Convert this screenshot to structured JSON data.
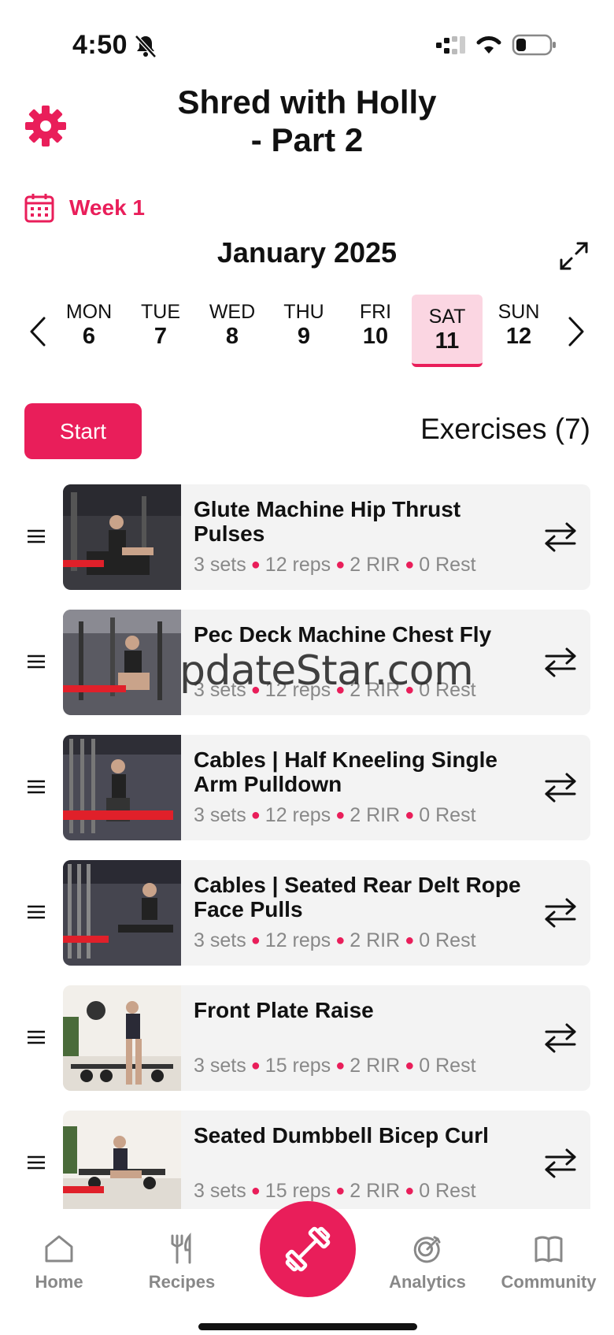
{
  "status_bar": {
    "time": "4:50"
  },
  "header": {
    "title": "Shred with Holly\n- Part 2"
  },
  "week": {
    "label": "Week 1"
  },
  "calendar": {
    "month": "January 2025",
    "days": [
      {
        "name": "MON",
        "num": "6"
      },
      {
        "name": "TUE",
        "num": "7"
      },
      {
        "name": "WED",
        "num": "8"
      },
      {
        "name": "THU",
        "num": "9"
      },
      {
        "name": "FRI",
        "num": "10"
      },
      {
        "name": "SAT",
        "num": "11",
        "selected": true
      },
      {
        "name": "SUN",
        "num": "12"
      }
    ]
  },
  "actions": {
    "start_label": "Start",
    "exercises_label": "Exercises (7)"
  },
  "exercises": [
    {
      "name": "Glute Machine Hip Thrust Pulses",
      "sets": "3 sets",
      "reps": "12 reps",
      "rir": "2 RIR",
      "rest": "0 Rest"
    },
    {
      "name": "Pec Deck Machine Chest Fly",
      "sets": "3 sets",
      "reps": "12 reps",
      "rir": "2 RIR",
      "rest": "0 Rest"
    },
    {
      "name": "Cables | Half Kneeling Single Arm Pulldown",
      "sets": "3 sets",
      "reps": "12 reps",
      "rir": "2 RIR",
      "rest": "0 Rest"
    },
    {
      "name": "Cables | Seated Rear Delt Rope Face Pulls",
      "sets": "3 sets",
      "reps": "12 reps",
      "rir": "2 RIR",
      "rest": "0 Rest"
    },
    {
      "name": "Front Plate Raise",
      "sets": "3 sets",
      "reps": "15 reps",
      "rir": "2 RIR",
      "rest": "0 Rest"
    },
    {
      "name": "Seated Dumbbell Bicep Curl",
      "sets": "3 sets",
      "reps": "15 reps",
      "rir": "2 RIR",
      "rest": "0 Rest"
    }
  ],
  "watermark": "pdateStar.com",
  "nav": {
    "home": "Home",
    "recipes": "Recipes",
    "analytics": "Analytics",
    "community": "Community"
  },
  "colors": {
    "accent": "#e91e5a",
    "selected_day_bg": "#fbd6e2",
    "card_bg": "#f3f3f3",
    "muted_text": "#888888"
  },
  "icons": {
    "settings": "gear-icon",
    "week": "calendar-icon",
    "expand": "expand-icon",
    "swap": "swap-icon",
    "drag": "drag-handle-icon",
    "workout": "dumbbell-icon"
  }
}
